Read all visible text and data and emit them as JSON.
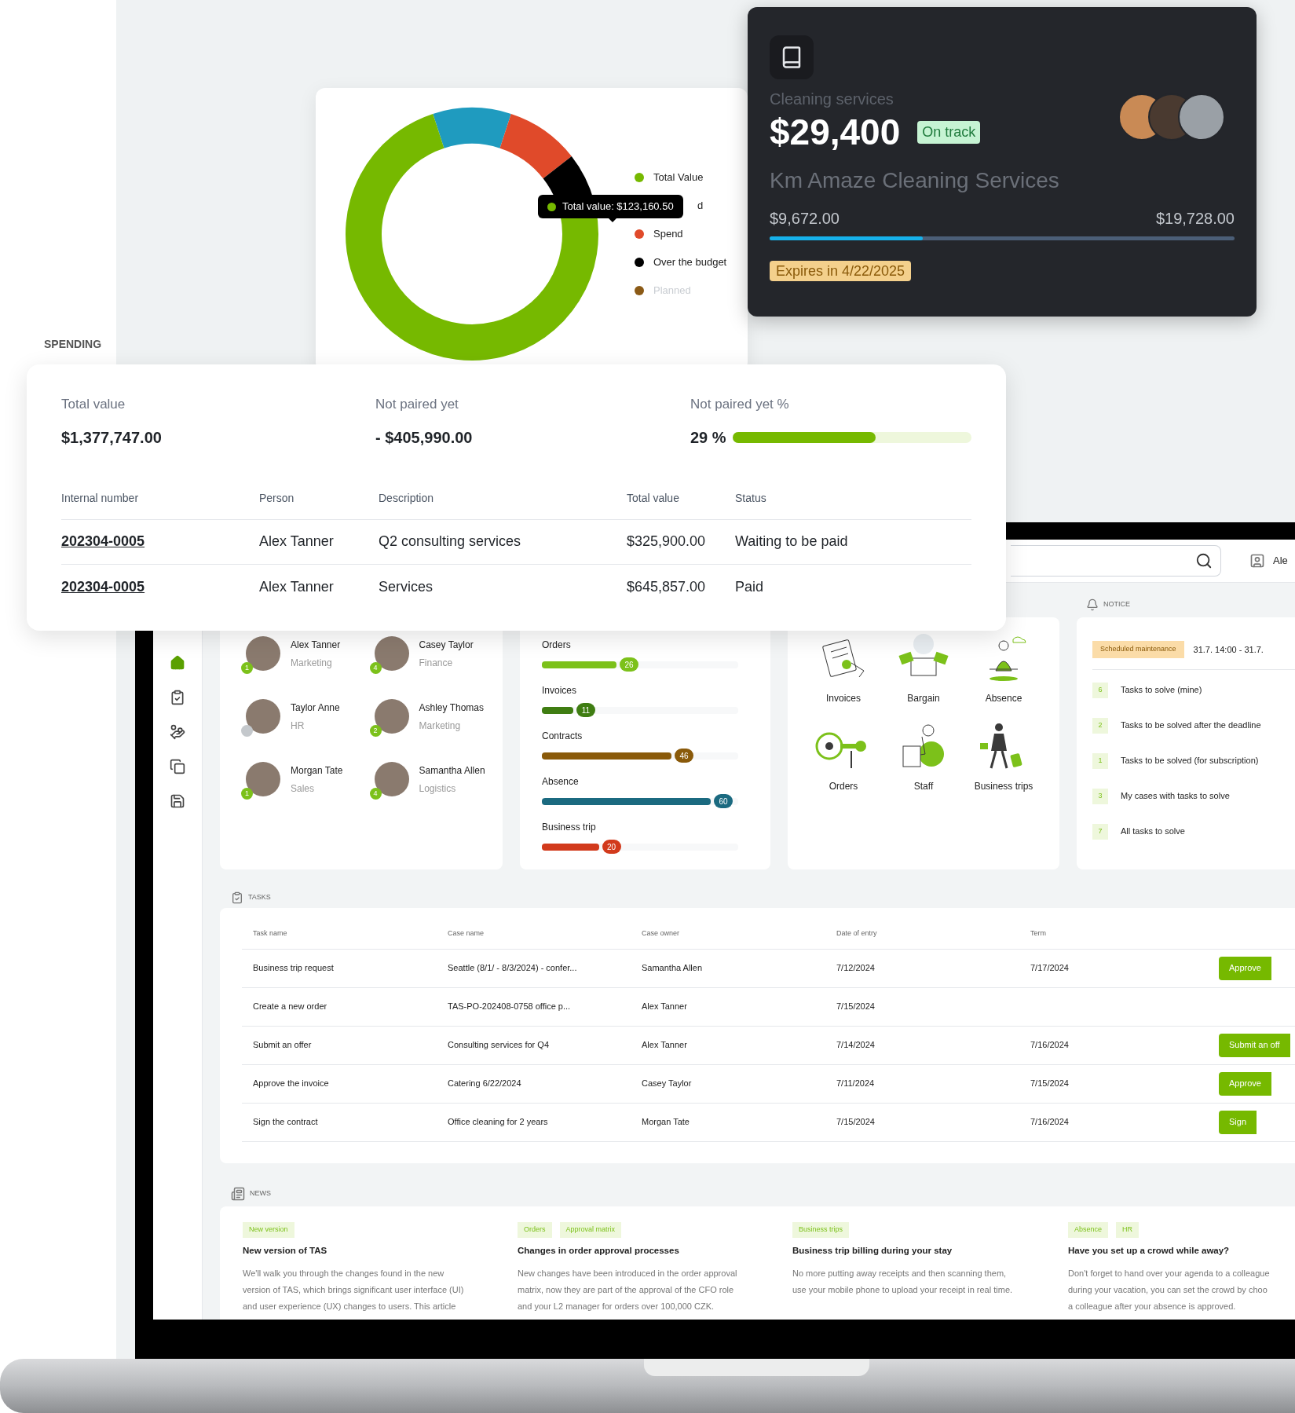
{
  "spending_label": "SPENDING",
  "donut_card": {
    "legend": [
      {
        "kind": "entry",
        "label": "Total Value",
        "color": "#76b900",
        "disabled": false
      },
      {
        "kind": "partial",
        "label": "d"
      },
      {
        "kind": "entry",
        "label": "Spend",
        "color": "#e04a2a",
        "disabled": false
      },
      {
        "kind": "entry",
        "label": "Over the budget",
        "color": "#000000",
        "disabled": false
      },
      {
        "kind": "entry",
        "label": "Planned",
        "color": "#8b5a16",
        "disabled": true
      }
    ],
    "tooltip": {
      "text": "Total value: $123,160.50",
      "color": "#76b900"
    }
  },
  "contract_card": {
    "category": "Cleaning services",
    "amount": "$29,400",
    "status": "On track",
    "supplier": "Km Amaze Cleaning Services",
    "spent": "$9,672.00",
    "total": "$19,728.00",
    "level": 0.33,
    "expiry": "Expires in 4/22/2025"
  },
  "spending": {
    "stats": [
      {
        "label": "Total value",
        "value": "$1,377,747.00"
      },
      {
        "label": "Not paired yet",
        "value": "- $405,990.00"
      }
    ],
    "percent": {
      "label": "Not paired yet %",
      "value": "29 %",
      "level": 0.6
    },
    "columns": [
      "Internal number",
      "Person",
      "Description",
      "Total value",
      "Status"
    ],
    "rows": [
      {
        "cells": [
          "202304-0005",
          "Alex Tanner",
          "Q2 consulting services",
          "$325,900.00",
          "Waiting to be paid"
        ]
      },
      {
        "cells": [
          "202304-0005",
          "Alex Tanner",
          "Services",
          "$645,857.00",
          "Paid"
        ]
      }
    ]
  },
  "dashboard": {
    "user": "Ale",
    "sidebar": [
      {
        "kind": "home",
        "selected": true
      },
      {
        "kind": "tasks",
        "selected": false
      },
      {
        "kind": "payments",
        "selected": false
      },
      {
        "kind": "documents",
        "selected": false
      },
      {
        "kind": "save",
        "selected": false
      }
    ],
    "people": [
      {
        "name": "Alex Tanner",
        "role": "Marketing",
        "badge": "1",
        "badge_active": true
      },
      {
        "name": "Casey Taylor",
        "role": "Finance",
        "badge": "4",
        "badge_active": true
      },
      {
        "name": "Taylor Anne",
        "role": "HR",
        "badge_active": false
      },
      {
        "name": "Ashley Thomas",
        "role": "Marketing",
        "badge": "2",
        "badge_active": true
      },
      {
        "name": "Morgan Tate",
        "role": "Sales",
        "badge": "1",
        "badge_active": true
      },
      {
        "name": "Samantha Allen",
        "role": "Logistics",
        "badge": "4",
        "badge_active": true
      }
    ],
    "counters": [
      {
        "label": "Orders",
        "count": "26",
        "color": "#7cc11a",
        "level": 0.38
      },
      {
        "label": "Invoices",
        "count": "11",
        "color": "#3f7d12",
        "level": 0.16
      },
      {
        "label": "Contracts",
        "count": "46",
        "color": "#8a5a0a",
        "level": 0.66
      },
      {
        "label": "Absence",
        "count": "60",
        "color": "#1b6a80",
        "level": 0.86
      },
      {
        "label": "Business trip",
        "count": "20",
        "color": "#d23a1c",
        "level": 0.29
      }
    ],
    "shortcuts": [
      {
        "label": "Invoices",
        "kind": "invoices"
      },
      {
        "label": "Bargain",
        "kind": "bargain"
      },
      {
        "label": "Absence",
        "kind": "absence"
      },
      {
        "label": "Orders",
        "kind": "orders"
      },
      {
        "label": "Staff",
        "kind": "staff"
      },
      {
        "label": "Business trips",
        "kind": "trips"
      }
    ],
    "notice": {
      "heading": "NOTICE",
      "tag": "Scheduled maintenance",
      "time": "31.7. 14:00 - 31.7.",
      "items": [
        {
          "count": "6",
          "label": "Tasks to solve (mine)"
        },
        {
          "count": "2",
          "label": "Tasks to be solved after the deadline"
        },
        {
          "count": "1",
          "label": "Tasks to be solved (for subscription)"
        },
        {
          "count": "3",
          "label": "My cases with tasks to solve"
        },
        {
          "count": "7",
          "label": "All tasks to solve"
        }
      ]
    },
    "tasks": {
      "heading": "TASKS",
      "columns": [
        "Task name",
        "Case name",
        "Case owner",
        "Date of entry",
        "Term"
      ],
      "rows": [
        {
          "cells": [
            "Business trip request",
            "Seattle (8/1/ - 8/3/2024) - confer...",
            "Samantha Allen",
            "7/12/2024",
            "7/17/2024"
          ],
          "action": "Approve"
        },
        {
          "cells": [
            "Create a new order",
            "TAS-PO-202408-0758 office p...",
            "Alex Tanner",
            "7/15/2024",
            ""
          ]
        },
        {
          "cells": [
            "Submit an offer",
            "Consulting services for Q4",
            "Alex Tanner",
            "7/14/2024",
            "7/16/2024"
          ],
          "action": "Submit an off"
        },
        {
          "cells": [
            "Approve the invoice",
            "Catering 6/22/2024",
            "Casey Taylor",
            "7/11/2024",
            "7/15/2024"
          ],
          "action": "Approve"
        },
        {
          "cells": [
            "Sign the contract",
            "Office cleaning for 2 years",
            "Morgan Tate",
            "7/15/2024",
            "7/16/2024"
          ],
          "action": "Sign"
        }
      ]
    },
    "news": {
      "heading": "NEWS",
      "items": [
        {
          "tags": [
            "New version"
          ],
          "title": "New version of TAS",
          "lines": [
            "We'll walk you through the changes found in the new",
            "version of TAS, which brings significant user interface (UI)",
            "and user experience (UX) changes to users.  This article"
          ]
        },
        {
          "tags": [
            "Orders",
            "Approval matrix"
          ],
          "title": "Changes in order approval processes",
          "lines": [
            "New changes have been introduced in the order approval",
            "matrix, now they are part of the approval of the CFO role",
            "and your L2 manager for orders over 100,000 CZK."
          ]
        },
        {
          "tags": [
            "Business trips"
          ],
          "title": "Business trip billing during your stay",
          "lines": [
            "No more putting away receipts and then scanning them,",
            "use your mobile phone to upload your receipt in real time."
          ]
        },
        {
          "tags": [
            "Absence",
            "HR"
          ],
          "title": "Have you set up a crowd while away?",
          "lines": [
            "Don't forget to hand over your agenda to a colleague",
            "during your vacation, you can set the crowd by choo",
            "a colleague after your absence is approved."
          ]
        }
      ]
    }
  }
}
